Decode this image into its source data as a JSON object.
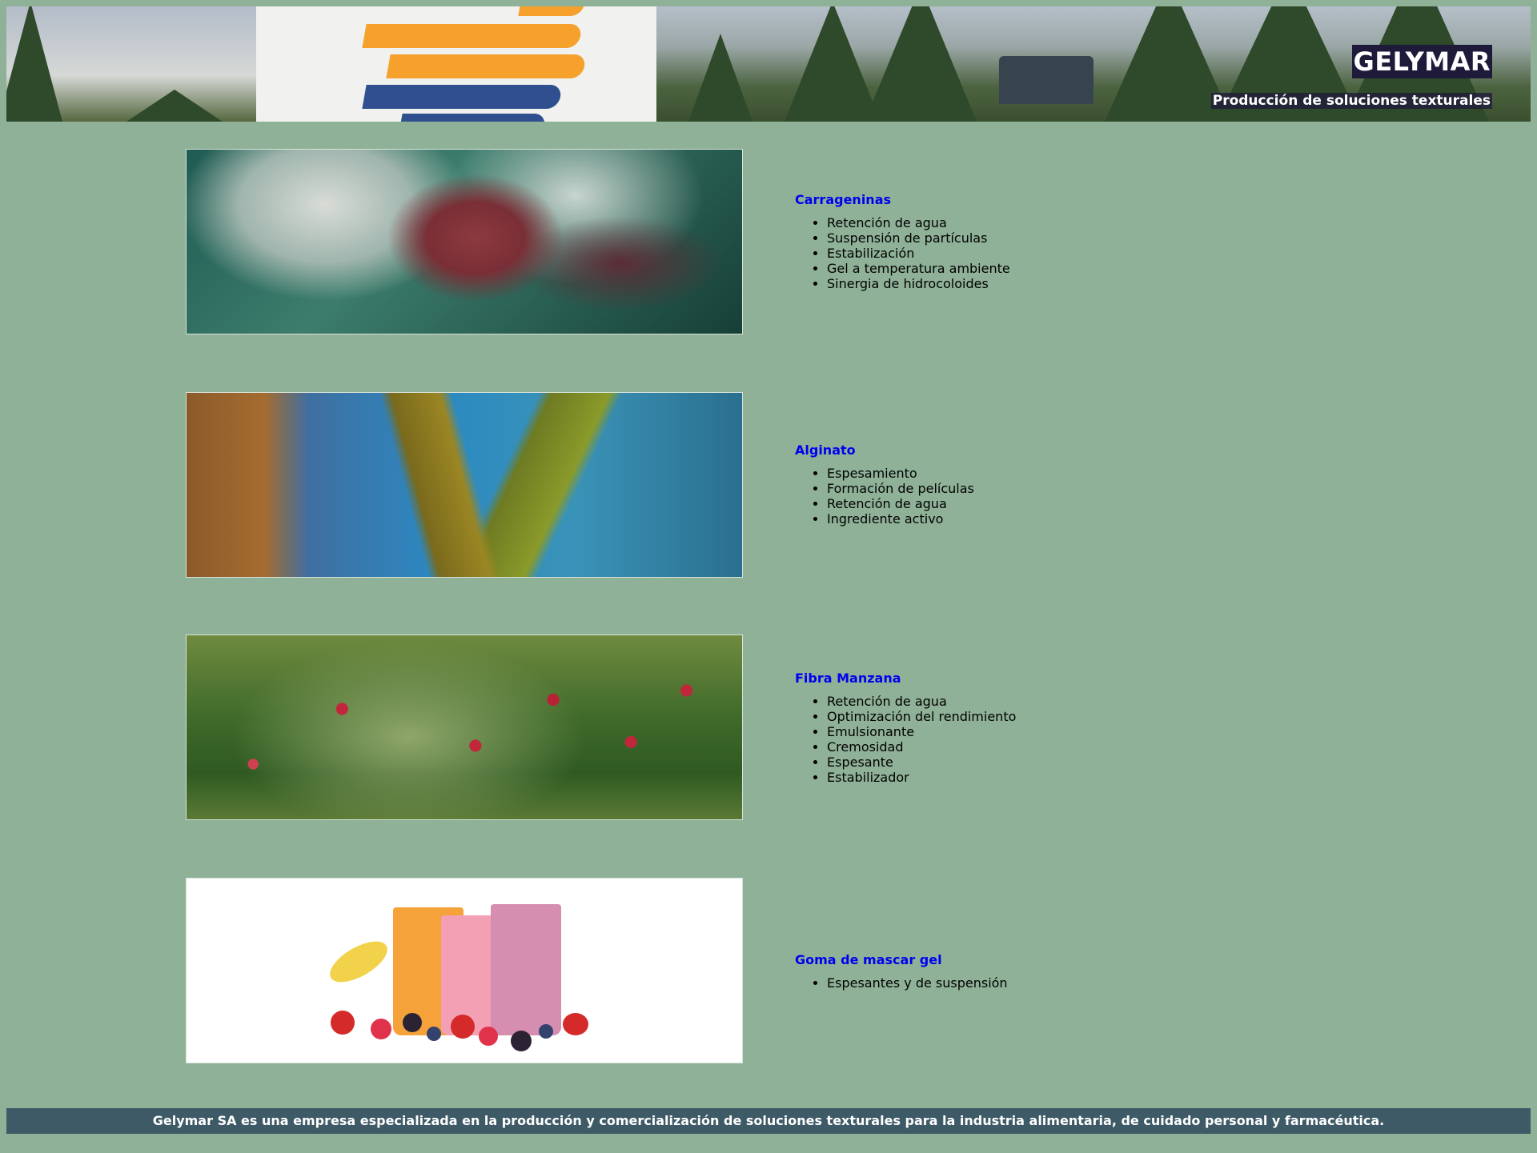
{
  "header": {
    "title": "GELYMAR",
    "subtitle": "Producción de soluciones texturales"
  },
  "products": [
    {
      "title": "Carrageninas",
      "image": "red-seaweed-underwater-photo",
      "features": [
        "Retención de agua",
        "Suspensión de partículas",
        "Estabilización",
        "Gel a temperatura ambiente",
        "Sinergia de hidrocoloides"
      ]
    },
    {
      "title": "Alginato",
      "image": "kelp-forest-photo",
      "features": [
        "Espesamiento",
        "Formación de películas",
        "Retención de agua",
        "Ingrediente activo"
      ]
    },
    {
      "title": "Fibra Manzana",
      "image": "apple-orchard-photo",
      "features": [
        "Retención de agua",
        "Optimización del rendimiento",
        "Emulsionante",
        "Cremosidad",
        "Espesante",
        "Estabilizador"
      ]
    },
    {
      "title": "Goma de mascar gel",
      "image": "fruit-smoothies-photo",
      "features": [
        "Espesantes y de suspensión"
      ]
    }
  ],
  "footer": {
    "text": "Gelymar SA es una empresa especializada en la producción y comercialización de soluciones texturales para la industria alimentaria, de cuidado personal y farmacéutica."
  },
  "colors": {
    "page_background": "#8fb197",
    "link": "#0000ee",
    "footer_background": "#3e5a66",
    "logo_orange": "#f5a12b",
    "logo_blue": "#2f4f8f"
  }
}
